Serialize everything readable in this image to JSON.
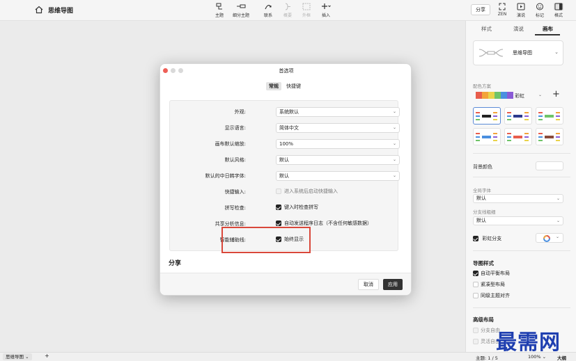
{
  "app": {
    "title": "思维导图"
  },
  "toolbar": {
    "topic": "主题",
    "subtopic": "细分主题",
    "relation": "联系",
    "summary": "概要",
    "boundary": "外框",
    "insert": "插入"
  },
  "right_toolbar": {
    "share": "分享",
    "zen": "ZEN",
    "present": "演说",
    "sticker": "标记",
    "format": "格式"
  },
  "panel": {
    "tabs": [
      "样式",
      "演说",
      "画布"
    ],
    "active_tab": "画布",
    "structure_label": "思维导图",
    "color_scheme_label": "配色方案",
    "color_scheme_value": "彩虹",
    "background_label": "背景颜色",
    "global_font_label": "全局字体",
    "global_font_value": "默认",
    "branch_label": "分支线粗细",
    "branch_value": "默认",
    "rainbow_branch": "彩虹分支",
    "map_style_heading": "导图样式",
    "auto_balance": "自动平衡布局",
    "compact": "紧凑型布局",
    "align_same_level": "同级主题对齐",
    "advanced_heading": "高级布局",
    "free_branch": "分支自由",
    "flexible": "灵活自由"
  },
  "dialog": {
    "title": "首选项",
    "tabs": [
      "常规",
      "快捷键"
    ],
    "rows": [
      {
        "label": "外观:",
        "value": "系统默认"
      },
      {
        "label": "显示语言:",
        "value": "简体中文"
      },
      {
        "label": "画布默认缩放:",
        "value": "100%"
      },
      {
        "label": "默认风格:",
        "value": "默认"
      },
      {
        "label": "默认的中日韩字体:",
        "value": "默认"
      }
    ],
    "quick_input": {
      "label": "快捷输入:",
      "text": "进入系统后启动快捷输入"
    },
    "spell_check": {
      "label": "拼写检查:",
      "text": "键入时检查拼写"
    },
    "analytics": {
      "label": "共享分析信息:",
      "text": "自动发送程序日志（不含任何敏感数据）"
    },
    "smart_guide": {
      "label": "智能辅助线:",
      "text": "始终显示"
    },
    "share_section": "分享",
    "cancel": "取消",
    "apply": "应用"
  },
  "statusbar": {
    "sheet": "思维导图",
    "add": "+",
    "topic_count": "主题: 1 / 5",
    "zoom": "100%",
    "outline": "大纲"
  },
  "watermark": "最需网",
  "colors": {
    "highlight": "#d9473a",
    "apply_bg": "#333333",
    "watermark": "#1f3fb0"
  }
}
